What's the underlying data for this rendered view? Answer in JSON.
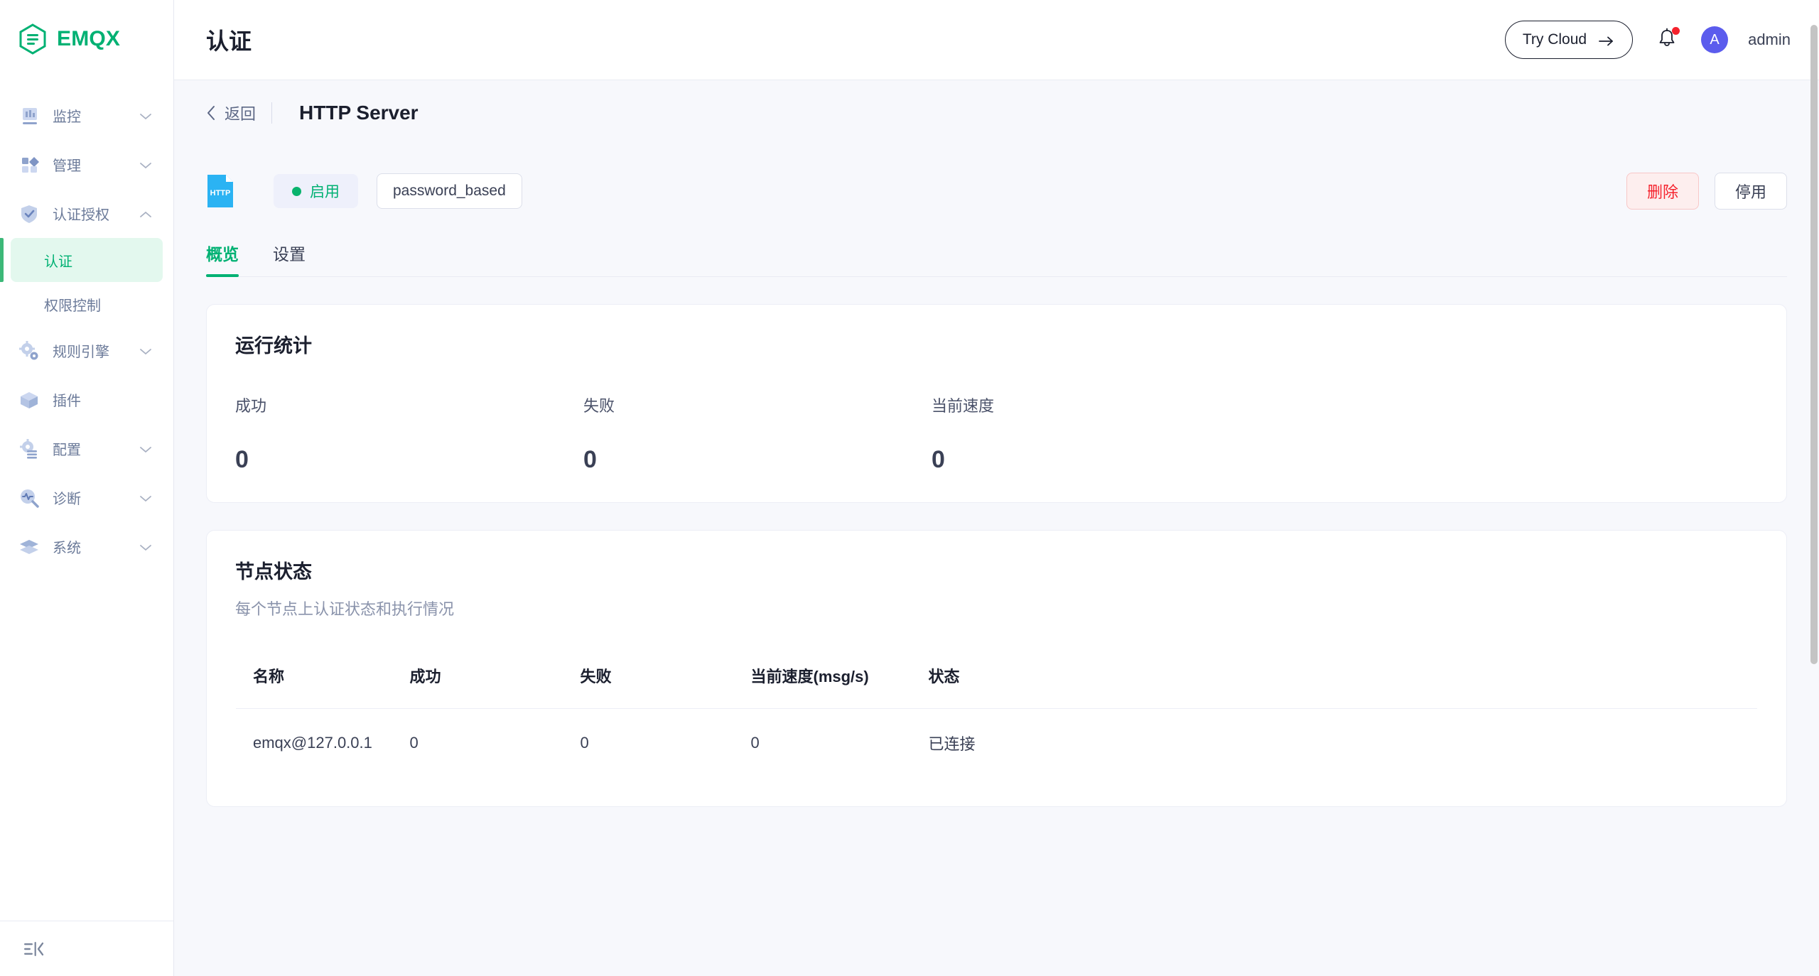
{
  "brand": {
    "name": "EMQX",
    "logo_icon": "emqx-hexagon-logo"
  },
  "sidebar": {
    "items": [
      {
        "label": "监控",
        "icon": "chart-bar-icon",
        "expandable": true,
        "expanded": false
      },
      {
        "label": "管理",
        "icon": "grid-blocks-icon",
        "expandable": true,
        "expanded": false
      },
      {
        "label": "认证授权",
        "icon": "shield-check-icon",
        "expandable": true,
        "expanded": true
      },
      {
        "label": "规则引擎",
        "icon": "gears-icon",
        "expandable": true,
        "expanded": false
      },
      {
        "label": "插件",
        "icon": "cube-icon",
        "expandable": false,
        "expanded": false
      },
      {
        "label": "配置",
        "icon": "gear-list-icon",
        "expandable": true,
        "expanded": false
      },
      {
        "label": "诊断",
        "icon": "pulse-search-icon",
        "expandable": true,
        "expanded": false
      },
      {
        "label": "系统",
        "icon": "layers-icon",
        "expandable": true,
        "expanded": false
      }
    ],
    "sub_items": [
      {
        "label": "认证",
        "active": true
      },
      {
        "label": "权限控制",
        "active": false
      }
    ],
    "collapse_icon": "sidebar-collapse-icon"
  },
  "topbar": {
    "title": "认证",
    "try_cloud_label": "Try Cloud",
    "try_cloud_icon": "arrow-right-icon",
    "bell_icon": "bell-icon",
    "has_notification": true,
    "avatar_initial": "A",
    "username": "admin"
  },
  "breadcrumb": {
    "back_icon": "chevron-left-icon",
    "back_label": "返回",
    "title": "HTTP Server"
  },
  "resource_header": {
    "type_icon": "http-file-icon",
    "type_icon_label": "HTTP",
    "status_label": "启用",
    "mechanism_tag": "password_based",
    "delete_label": "删除",
    "disable_label": "停用"
  },
  "tabs": [
    {
      "label": "概览",
      "active": true
    },
    {
      "label": "设置",
      "active": false
    }
  ],
  "runtime_stats": {
    "title": "运行统计",
    "items": [
      {
        "label": "成功",
        "value": "0"
      },
      {
        "label": "失败",
        "value": "0"
      },
      {
        "label": "当前速度",
        "value": "0"
      }
    ]
  },
  "node_status": {
    "title": "节点状态",
    "subtitle": "每个节点上认证状态和执行情况",
    "columns": [
      "名称",
      "成功",
      "失败",
      "当前速度(msg/s)",
      "状态"
    ],
    "rows": [
      {
        "name": "emqx@127.0.0.1",
        "success": "0",
        "failed": "0",
        "rate": "0",
        "status": "已连接"
      }
    ]
  },
  "colors": {
    "accent_green": "#00b173",
    "danger_red": "#f5222d",
    "avatar_purple": "#5b5ced",
    "http_blue": "#2bb3f3",
    "page_bg": "#f7f8fc"
  }
}
